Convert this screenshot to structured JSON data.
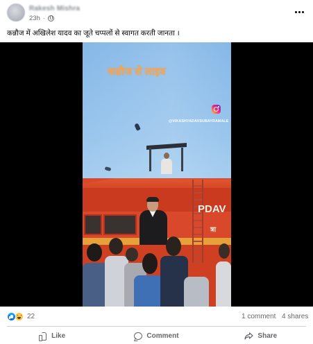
{
  "post": {
    "author_name": "Rakesh Mishra",
    "timestamp": "23h",
    "audience_icon": "globe-icon",
    "caption": "कन्नौज में अखिलेश यादव का जूते चप्पलों से स्वागत करती जानता ।"
  },
  "video": {
    "overlay_text": "कन्नौज से लाइव",
    "watermark": "@VIKASHYADAVSUBAYRAMALE",
    "bus_logo": "PDAV",
    "bus_logo_2": "त्रा"
  },
  "stats": {
    "reaction_count": "22",
    "comments": "1 comment",
    "shares": "4 shares"
  },
  "actions": {
    "like": "Like",
    "comment": "Comment",
    "share": "Share"
  },
  "colors": {
    "facebook_blue": "#0866ff",
    "secondary_text": "#65676b",
    "bus_red": "#d9482a",
    "overlay_orange": "#f2a552"
  }
}
